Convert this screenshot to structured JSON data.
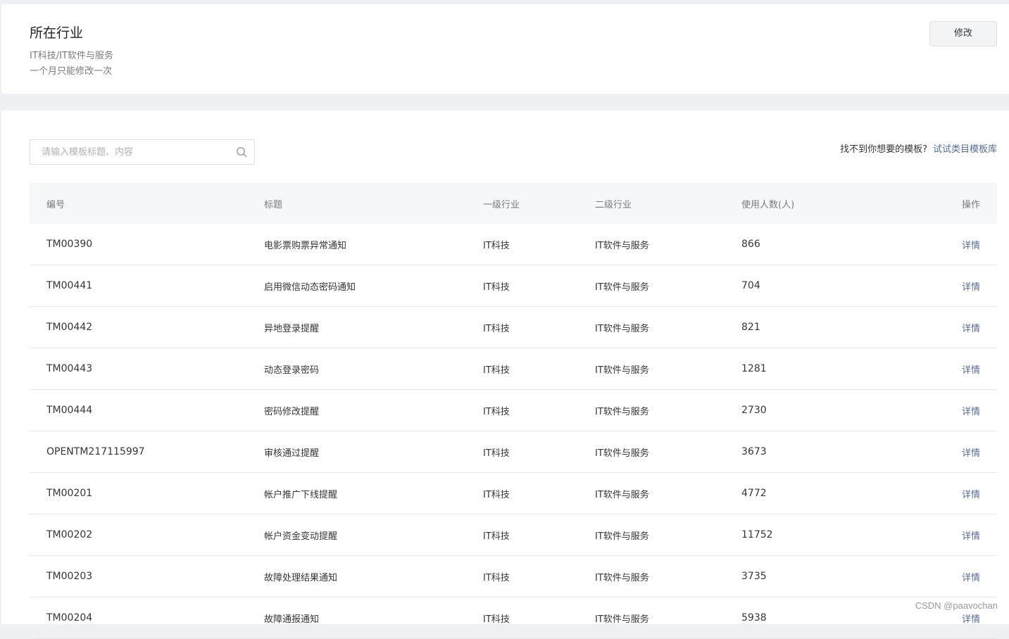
{
  "industry": {
    "title": "所在行业",
    "path": "IT科技/IT软件与服务",
    "note": "一个月只能修改一次",
    "modify_label": "修改"
  },
  "search": {
    "placeholder": "请输入模板标题、内容"
  },
  "hint": {
    "text": "找不到你想要的模板?",
    "link": "试试类目模板库"
  },
  "table": {
    "headers": {
      "id": "编号",
      "title": "标题",
      "level1": "一级行业",
      "level2": "二级行业",
      "users": "使用人数(人)",
      "op": "操作"
    },
    "rows": [
      {
        "id": "TM00390",
        "title": "电影票购票异常通知",
        "level1": "IT科技",
        "level2": "IT软件与服务",
        "users": "866",
        "op": "详情"
      },
      {
        "id": "TM00441",
        "title": "启用微信动态密码通知",
        "level1": "IT科技",
        "level2": "IT软件与服务",
        "users": "704",
        "op": "详情"
      },
      {
        "id": "TM00442",
        "title": "异地登录提醒",
        "level1": "IT科技",
        "level2": "IT软件与服务",
        "users": "821",
        "op": "详情"
      },
      {
        "id": "TM00443",
        "title": "动态登录密码",
        "level1": "IT科技",
        "level2": "IT软件与服务",
        "users": "1281",
        "op": "详情"
      },
      {
        "id": "TM00444",
        "title": "密码修改提醒",
        "level1": "IT科技",
        "level2": "IT软件与服务",
        "users": "2730",
        "op": "详情"
      },
      {
        "id": "OPENTM217115997",
        "title": "审核通过提醒",
        "level1": "IT科技",
        "level2": "IT软件与服务",
        "users": "3673",
        "op": "详情"
      },
      {
        "id": "TM00201",
        "title": "帐户推广下线提醒",
        "level1": "IT科技",
        "level2": "IT软件与服务",
        "users": "4772",
        "op": "详情"
      },
      {
        "id": "TM00202",
        "title": "帐户资金变动提醒",
        "level1": "IT科技",
        "level2": "IT软件与服务",
        "users": "11752",
        "op": "详情"
      },
      {
        "id": "TM00203",
        "title": "故障处理结果通知",
        "level1": "IT科技",
        "level2": "IT软件与服务",
        "users": "3735",
        "op": "详情"
      },
      {
        "id": "TM00204",
        "title": "故障通报通知",
        "level1": "IT科技",
        "level2": "IT软件与服务",
        "users": "5938",
        "op": "详情"
      }
    ]
  },
  "watermark": "CSDN @paavochan"
}
